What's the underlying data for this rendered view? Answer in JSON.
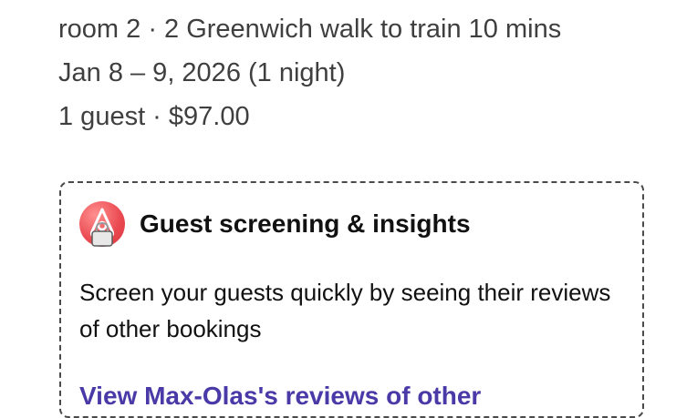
{
  "reservation": {
    "listing_line": "room 2 · 2 Greenwich walk to train 10 mins",
    "dates_line": "Jan 8 – 9, 2026 (1 night)",
    "guests_price_line": "1 guest · $97.00"
  },
  "screening_card": {
    "icon": "airbnb-lock-badge-icon",
    "title": "Guest screening & insights",
    "description": "Screen your guests quickly by seeing their reviews of other bookings",
    "link_label": "View Max-Olas's reviews of other"
  },
  "colors": {
    "link": "#4a3aa8",
    "brand": "#e9484f",
    "border": "#4a4a4a"
  }
}
